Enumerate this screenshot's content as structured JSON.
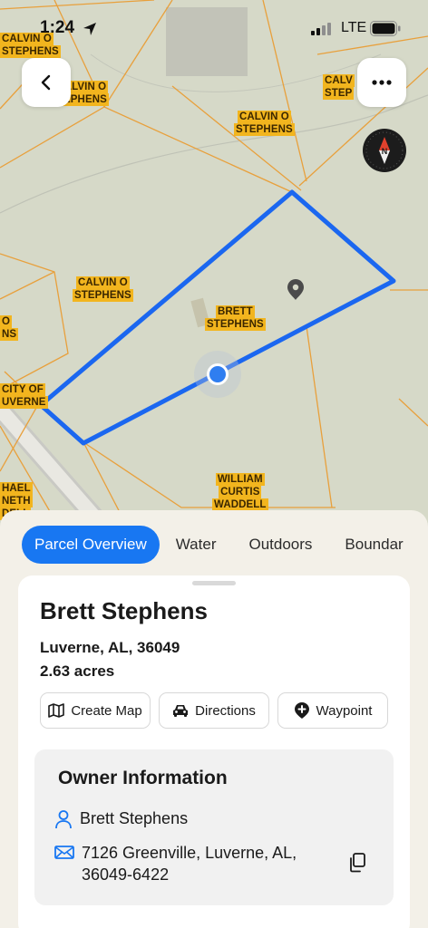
{
  "status_bar": {
    "time": "1:24",
    "network": "LTE"
  },
  "map": {
    "owner_labels": [
      {
        "id": "calvin-tl",
        "lines": [
          "CALVIN O",
          "STEPHENS"
        ]
      },
      {
        "id": "calvin-tl2",
        "lines": [
          "ALVIN O",
          "EPHENS"
        ]
      },
      {
        "id": "calvin-top",
        "lines": [
          "CALVIN O",
          "STEPHENS"
        ]
      },
      {
        "id": "calvin-tr",
        "lines": [
          "CALV",
          "STEP"
        ]
      },
      {
        "id": "calvin-mid",
        "lines": [
          "CALVIN O",
          "STEPHENS"
        ]
      },
      {
        "id": "brett",
        "lines": [
          "BRETT",
          "STEPHENS"
        ]
      },
      {
        "id": "left-edge",
        "lines": [
          "O",
          "NS"
        ]
      },
      {
        "id": "city",
        "lines": [
          "CITY OF",
          "UVERNE"
        ]
      },
      {
        "id": "william",
        "lines": [
          "WILLIAM",
          "CURTIS",
          "WADDELL"
        ]
      },
      {
        "id": "michael",
        "lines": [
          "HAEL",
          "NETH",
          "DELL"
        ]
      }
    ],
    "back_button_icon": "chevron-left-icon",
    "more_button_icon": "more-horizontal-icon",
    "compass_icon": "compass-north-icon",
    "accent_color": "#1b67f0",
    "parcel_line_color": "#e8a03c"
  },
  "sheet": {
    "tabs": [
      {
        "label": "Parcel Overview",
        "active": true
      },
      {
        "label": "Water",
        "active": false
      },
      {
        "label": "Outdoors",
        "active": false
      },
      {
        "label": "Boundar",
        "active": false
      }
    ],
    "parcel": {
      "owner": "Brett Stephens",
      "location": "Luverne, AL, 36049",
      "acres": "2.63 acres"
    },
    "actions": {
      "create_map": "Create Map",
      "directions": "Directions",
      "waypoint": "Waypoint"
    },
    "owner_info": {
      "heading": "Owner Information",
      "name": "Brett Stephens",
      "address": "7126 Greenville, Luverne, AL, 36049-6422"
    }
  }
}
